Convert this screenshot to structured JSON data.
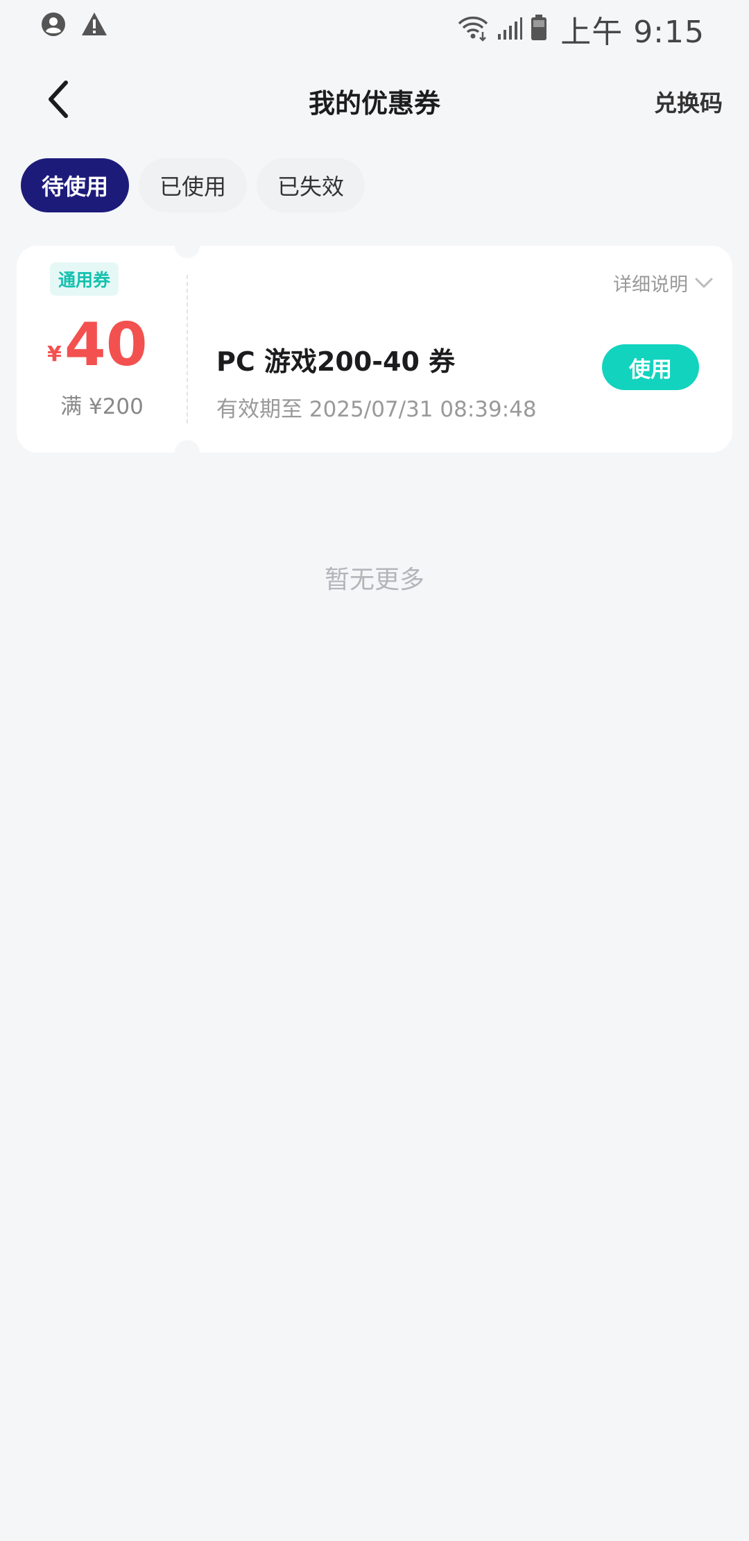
{
  "status_bar": {
    "time": "上午 9:15",
    "icons": [
      "account-circle-icon",
      "warning-icon",
      "wifi-icon",
      "signal-icon",
      "battery-icon"
    ]
  },
  "nav": {
    "back_icon": "chevron-left-icon",
    "title": "我的优惠券",
    "redeem_label": "兑换码"
  },
  "tabs": [
    {
      "label": "待使用",
      "active": true
    },
    {
      "label": "已使用",
      "active": false
    },
    {
      "label": "已失效",
      "active": false
    }
  ],
  "coupons": [
    {
      "type_badge": "通用券",
      "currency_symbol": "¥",
      "amount": "40",
      "threshold": "满 ¥200",
      "name": "PC 游戏200-40 券",
      "expiry": "有效期至 2025/07/31 08:39:48",
      "details_label": "详细说明",
      "use_label": "使用"
    }
  ],
  "footer": {
    "no_more_text": "暂无更多"
  },
  "colors": {
    "background": "#f5f6f8",
    "active_tab": "#1d1b7a",
    "accent_teal": "#12d3be",
    "amount_red": "#f2514f"
  }
}
